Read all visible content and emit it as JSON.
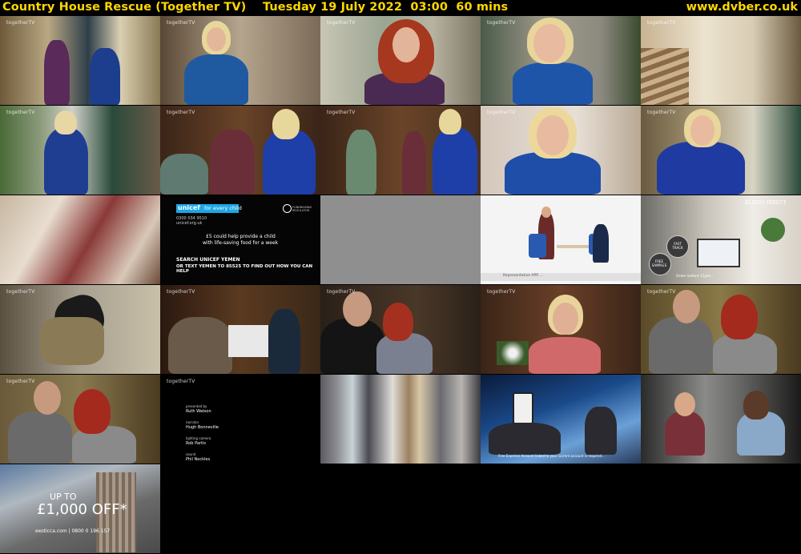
{
  "header": {
    "title": "Country House Rescue (Together TV)    Tuesday 19 July 2022  03:00  60 mins",
    "site": "www.dvber.co.uk"
  },
  "colors": {
    "header_text": "#ffd700",
    "background": "#000000"
  },
  "watermark": "togetherTV",
  "unicef": {
    "logo": "unicef",
    "tagline": "for every child",
    "phone": "0300 034 9510",
    "web": "unicef.org.uk",
    "line1": "£5 could help provide a child",
    "line2": "with life-saving food for a week",
    "cta1": "SEARCH UNICEF YEMEN",
    "cta2": "OR TEXT YEMEN TO 85525 TO FIND OUT HOW YOU CAN HELP",
    "reg": "FUNDRAISING REGULATOR"
  },
  "office_ad": {
    "caption": "Representative APR ..."
  },
  "blinds_ad": {
    "brand": "BLINDS DIRECT",
    "badge1": "FAST TRACK",
    "badge2": "FREE SAMPLES",
    "caption": "Order before 11pm..."
  },
  "credits": [
    {
      "role": "presented by",
      "name": "Ruth Watson"
    },
    {
      "role": "narrator",
      "name": "Hugh Bonneville"
    },
    {
      "role": "lighting camera",
      "name": "Rob Partis"
    },
    {
      "role": "sound",
      "name": "Phil Nockles"
    }
  ],
  "experian_ad": {
    "caption": "Free Experian Account linked to your current account is required..."
  },
  "travel_ad": {
    "line1": "UP TO",
    "line2": "£1,000 OFF*",
    "web": "exoticca.com  |  0800 0 196 157"
  }
}
